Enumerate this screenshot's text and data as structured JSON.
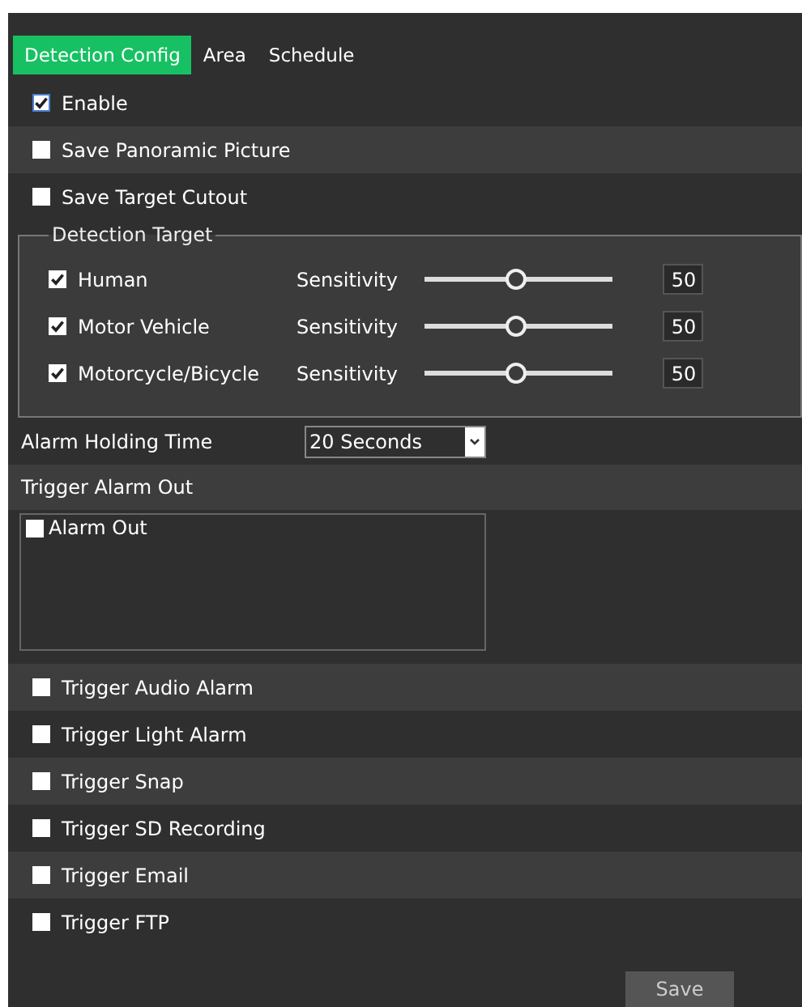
{
  "tabs": [
    {
      "label": "Detection Config",
      "selected": true
    },
    {
      "label": "Area",
      "selected": false
    },
    {
      "label": "Schedule",
      "selected": false
    }
  ],
  "options": [
    {
      "label": "Enable",
      "checked": true
    },
    {
      "label": "Save Panoramic Picture",
      "checked": false
    },
    {
      "label": "Save Target Cutout",
      "checked": false
    }
  ],
  "detection_target": {
    "legend": "Detection Target",
    "targets": [
      {
        "label": "Human",
        "checked": true,
        "sensitivity_label": "Sensitivity",
        "level": 0.48,
        "value": "50"
      },
      {
        "label": "Motor Vehicle",
        "checked": true,
        "sensitivity_label": "Sensitivity",
        "level": 0.48,
        "value": "50"
      },
      {
        "label": "Motorcycle/Bicycle",
        "checked": true,
        "sensitivity_label": "Sensitivity",
        "level": 0.48,
        "value": "50"
      }
    ]
  },
  "alarm_holding_time": {
    "label": "Alarm Holding Time",
    "value": "20 Seconds"
  },
  "trigger_alarm_out": {
    "label": "Trigger Alarm Out",
    "outputs": [
      {
        "label": "Alarm Out",
        "checked": false
      }
    ]
  },
  "triggers": [
    {
      "label": "Trigger Audio Alarm",
      "checked": false
    },
    {
      "label": "Trigger Light Alarm",
      "checked": false
    },
    {
      "label": "Trigger Snap",
      "checked": false
    },
    {
      "label": "Trigger SD Recording",
      "checked": false
    },
    {
      "label": "Trigger Email",
      "checked": false
    },
    {
      "label": "Trigger FTP",
      "checked": false
    }
  ],
  "save_button": "Save"
}
